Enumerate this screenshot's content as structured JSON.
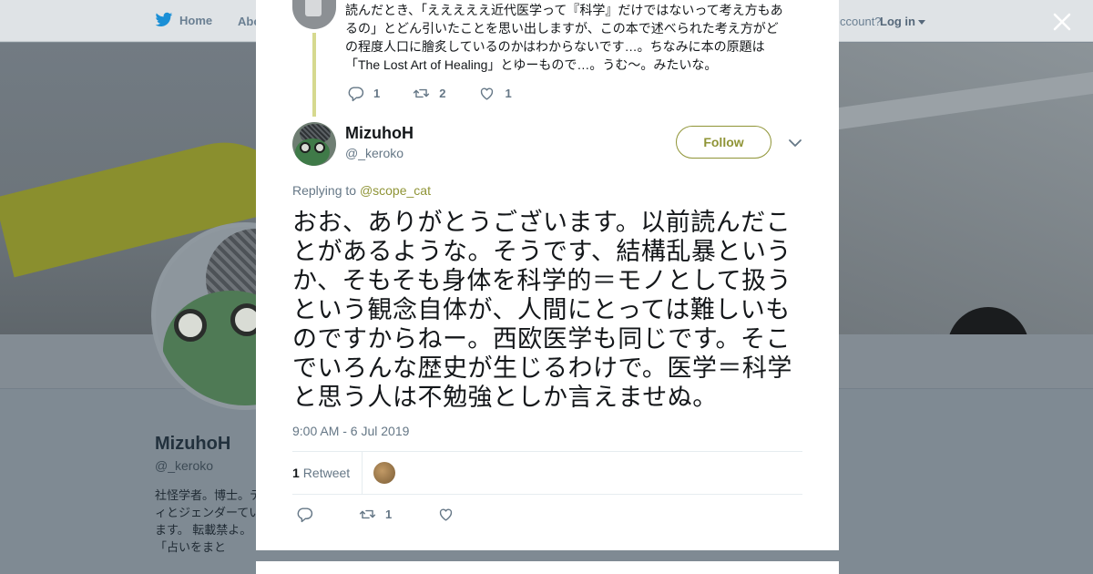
{
  "nav": {
    "home_label": "Home",
    "about_label": "Abo",
    "account_prompt": "ccount?",
    "login_label": "Log in"
  },
  "profile": {
    "name": "MizuhoH",
    "handle": "@_keroko",
    "bio": "社怪学者。博士。ティとジェンダーています。 転載禁よ。「占いをまと"
  },
  "parent_tweet": {
    "text": "読んだとき、「えええええ近代医学って『科学』だけではないって考え方もあるの」とどん引いたことを思い出しますが、この本で述べられた考え方がどの程度人口に膾炙しているのかはわからないです…。ちなみに本の原題は「The Lost Art of Healing」とゆーもので…。うむ～。みたいな。",
    "reply_count": "1",
    "retweet_count": "2",
    "like_count": "1"
  },
  "tweet": {
    "author_name": "MizuhoH",
    "author_handle": "@_keroko",
    "follow_label": "Follow",
    "replying_prefix": "Replying to",
    "replying_handle": "@scope_cat",
    "text": "おお、ありがとうございます。以前読んだことがあるような。そうです、結構乱暴というか、そもそも身体を科学的＝モノとして扱うという観念自体が、人間にとっては難しいものですからねー。西欧医学も同じです。そこでいろんな歴史が生じるわけで。医学＝科学と思う人は不勉強としか言えませぬ。",
    "timestamp": "9:00 AM - 6 Jul 2019",
    "retweet_stat_count": "1",
    "retweet_stat_label": "Retweet",
    "retweet_count": "1"
  },
  "colors": {
    "accent": "#8f9436",
    "text_primary": "#14171a",
    "text_secondary": "#657786",
    "overlay_background": "#7f8a93"
  },
  "icons": [
    "twitter-bird-icon",
    "caret-down-icon",
    "close-icon",
    "reply-icon",
    "retweet-icon",
    "like-icon",
    "chevron-down-icon"
  ]
}
